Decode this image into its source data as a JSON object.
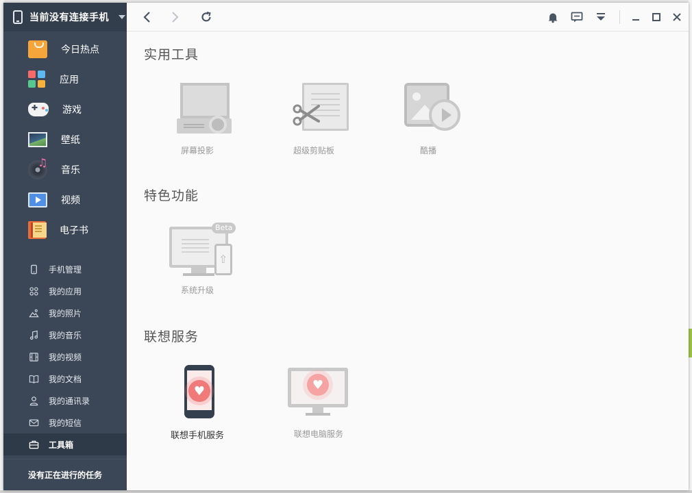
{
  "sidebar": {
    "device_label": "当前没有连接手机",
    "main_items": [
      {
        "label": "今日热点",
        "icon": "hot-icon"
      },
      {
        "label": "应用",
        "icon": "apps-icon"
      },
      {
        "label": "游戏",
        "icon": "game-icon"
      },
      {
        "label": "壁纸",
        "icon": "wallpaper-icon"
      },
      {
        "label": "音乐",
        "icon": "music-icon"
      },
      {
        "label": "视频",
        "icon": "video-icon"
      },
      {
        "label": "电子书",
        "icon": "ebook-icon"
      }
    ],
    "sub_items": [
      {
        "label": "手机管理",
        "icon": "phone-manage-icon"
      },
      {
        "label": "我的应用",
        "icon": "my-apps-icon"
      },
      {
        "label": "我的照片",
        "icon": "photo-icon"
      },
      {
        "label": "我的音乐",
        "icon": "music-note-icon"
      },
      {
        "label": "我的视频",
        "icon": "film-icon"
      },
      {
        "label": "我的文档",
        "icon": "book-icon"
      },
      {
        "label": "我的通讯录",
        "icon": "contact-icon"
      },
      {
        "label": "我的短信",
        "icon": "mail-icon"
      },
      {
        "label": "工具箱",
        "icon": "toolbox-icon",
        "active": true
      }
    ],
    "task_status": "没有正在进行的任务"
  },
  "toolbar": {
    "back_icon": "chevron-left-icon",
    "forward_icon": "chevron-right-icon",
    "refresh_icon": "refresh-icon",
    "bell_icon": "bell-icon",
    "message_icon": "message-icon",
    "menu_icon": "dropdown-menu-icon",
    "minimize_icon": "minimize-icon",
    "maximize_icon": "maximize-icon",
    "close_icon": "close-icon"
  },
  "sections": {
    "tools": {
      "title": "实用工具",
      "items": [
        {
          "label": "屏幕投影"
        },
        {
          "label": "超级剪贴板"
        },
        {
          "label": "酷播"
        }
      ]
    },
    "features": {
      "title": "特色功能",
      "items": [
        {
          "label": "系统升级",
          "badge": "Beta"
        }
      ]
    },
    "services": {
      "title": "联想服务",
      "items": [
        {
          "label": "联想手机服务"
        },
        {
          "label": "联想电脑服务"
        }
      ]
    }
  },
  "colors": {
    "sidebar_bg": "#3b4757",
    "sidebar_active_bg": "#2f3a48",
    "content_bg": "#fafafa",
    "heart": "#f07a7a"
  }
}
